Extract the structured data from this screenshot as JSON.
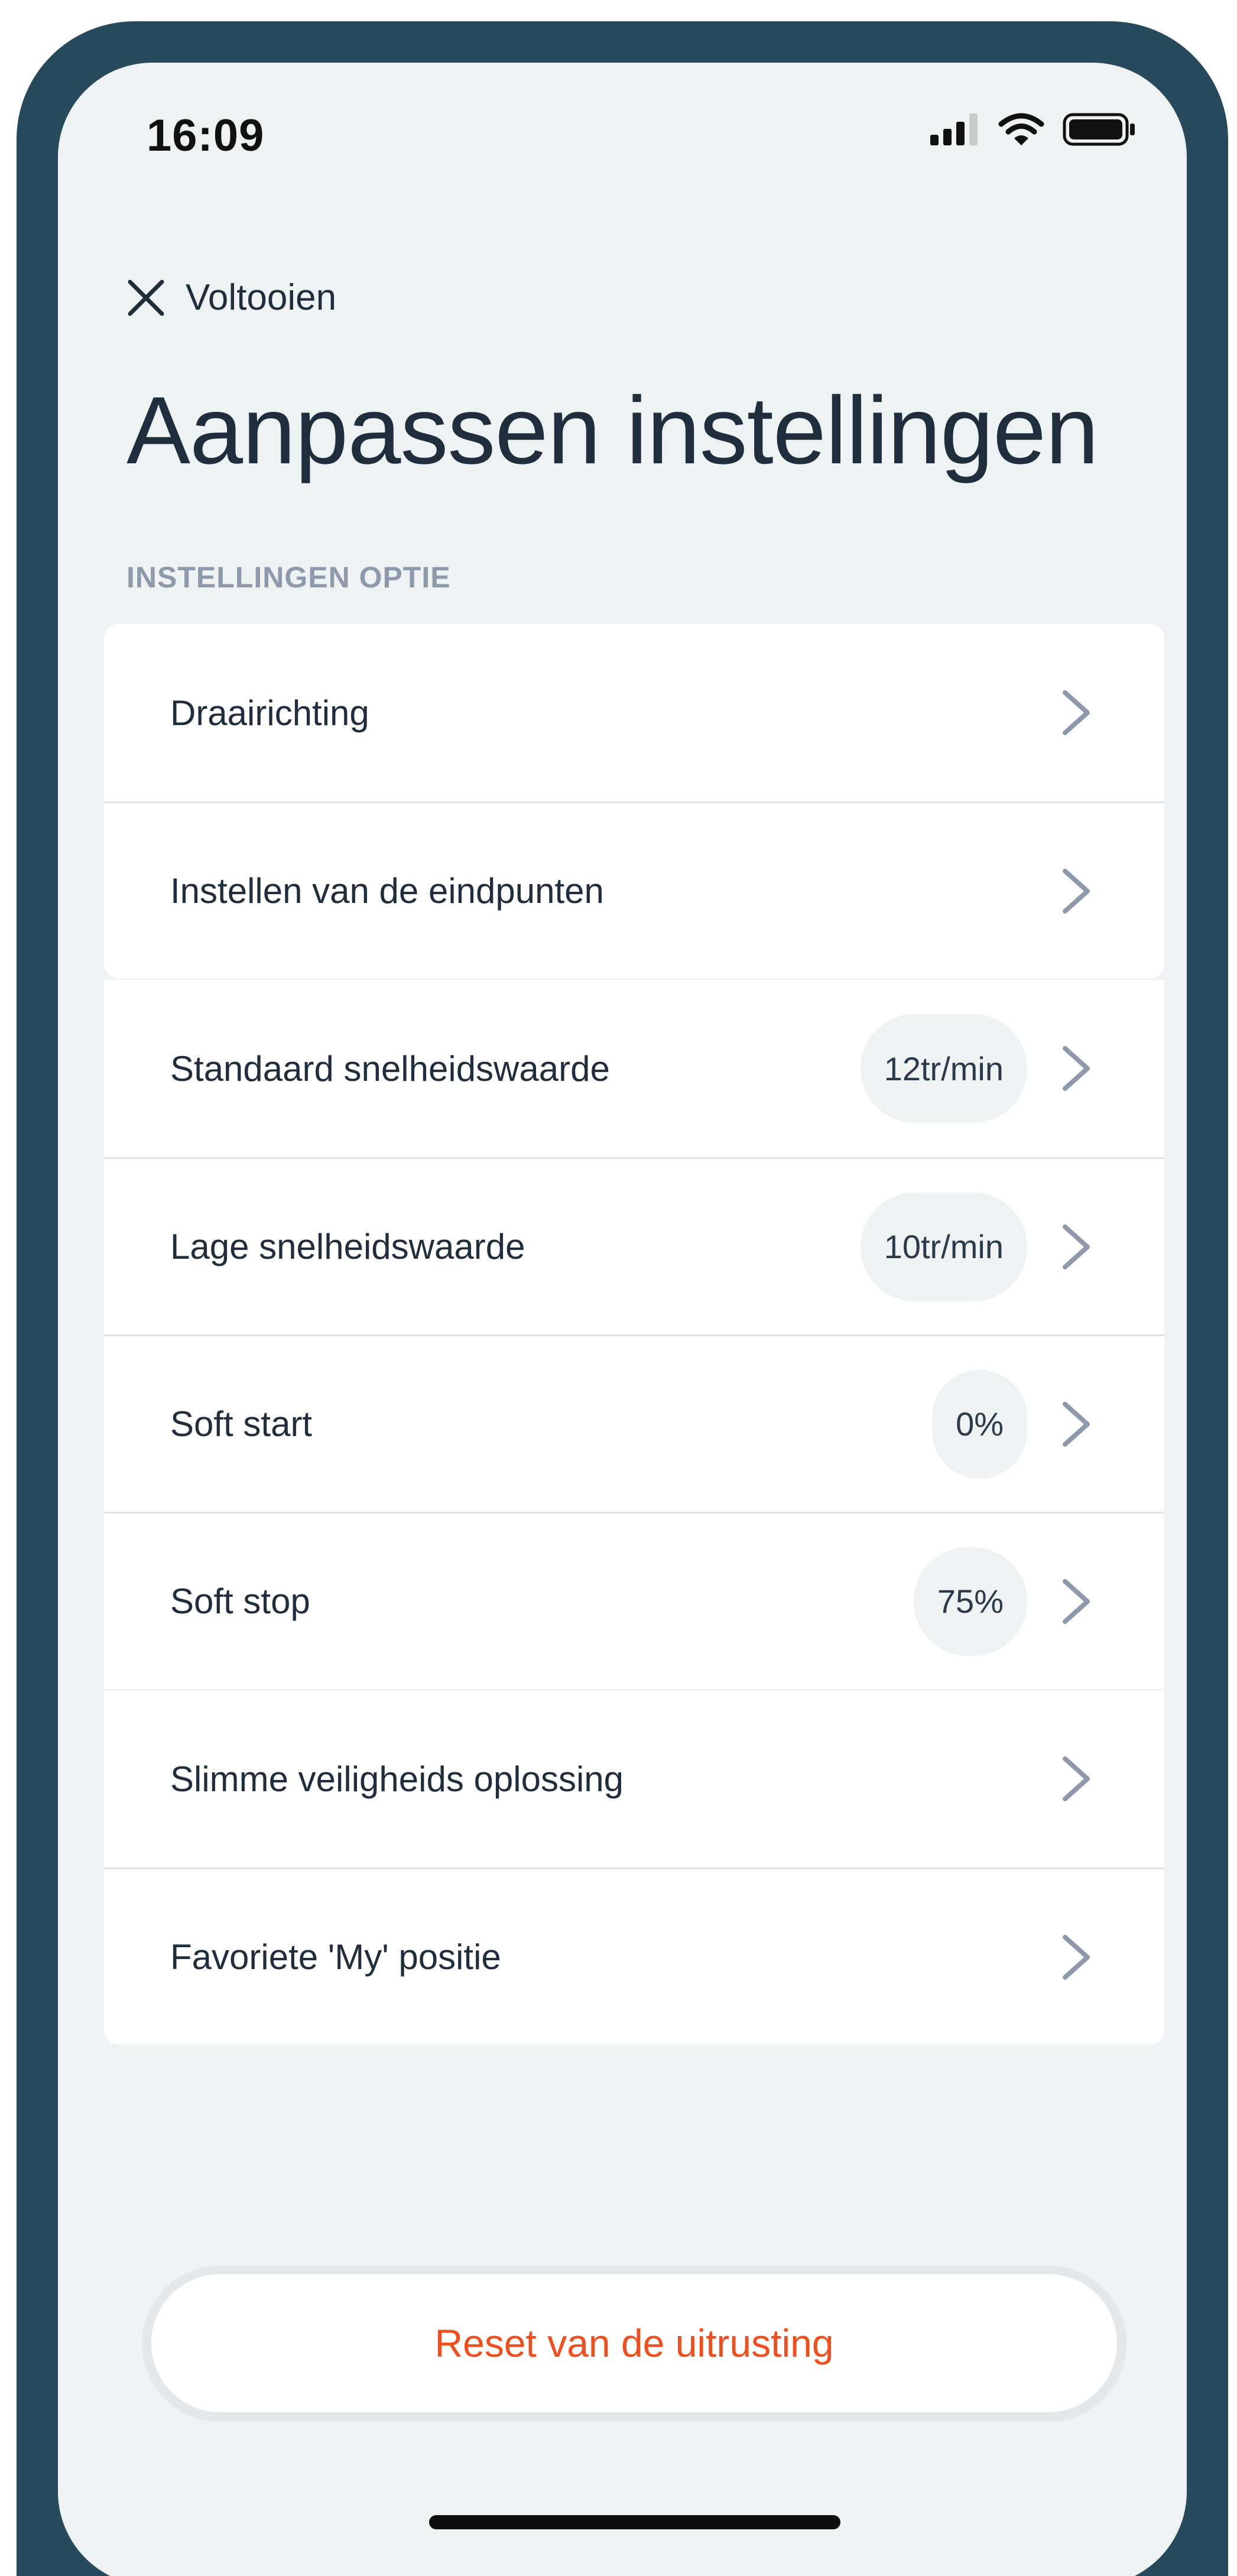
{
  "status_bar": {
    "time": "16:09",
    "icons": [
      "signal-icon",
      "wifi-icon",
      "battery-icon"
    ]
  },
  "nav": {
    "close_label": "Voltooien",
    "close_icon": "close-icon"
  },
  "page": {
    "title": "Aanpassen instellingen",
    "section_label": "INSTELLINGEN OPTIE"
  },
  "settings": {
    "group1": [
      {
        "label": "Draairichting",
        "value": null
      },
      {
        "label": "Instellen van de eindpunten",
        "value": null
      }
    ],
    "group2": [
      {
        "label": "Standaard snelheidswaarde",
        "value": "12tr/min"
      },
      {
        "label": "Lage snelheidswaarde",
        "value": "10tr/min"
      },
      {
        "label": "Soft start",
        "value": "0%"
      },
      {
        "label": "Soft stop",
        "value": "75%"
      }
    ],
    "group3": [
      {
        "label": "Slimme veiligheids oplossing",
        "value": null
      },
      {
        "label": "Favoriete 'My' positie",
        "value": null
      }
    ]
  },
  "reset": {
    "label": "Reset van de uitrusting"
  },
  "colors": {
    "frame": "#264a5c",
    "background": "#eef2f2",
    "text": "#1f2d3d",
    "section_label": "#8e9aab",
    "chevron": "#8e9aab",
    "accent_reset": "#f04e1c"
  }
}
